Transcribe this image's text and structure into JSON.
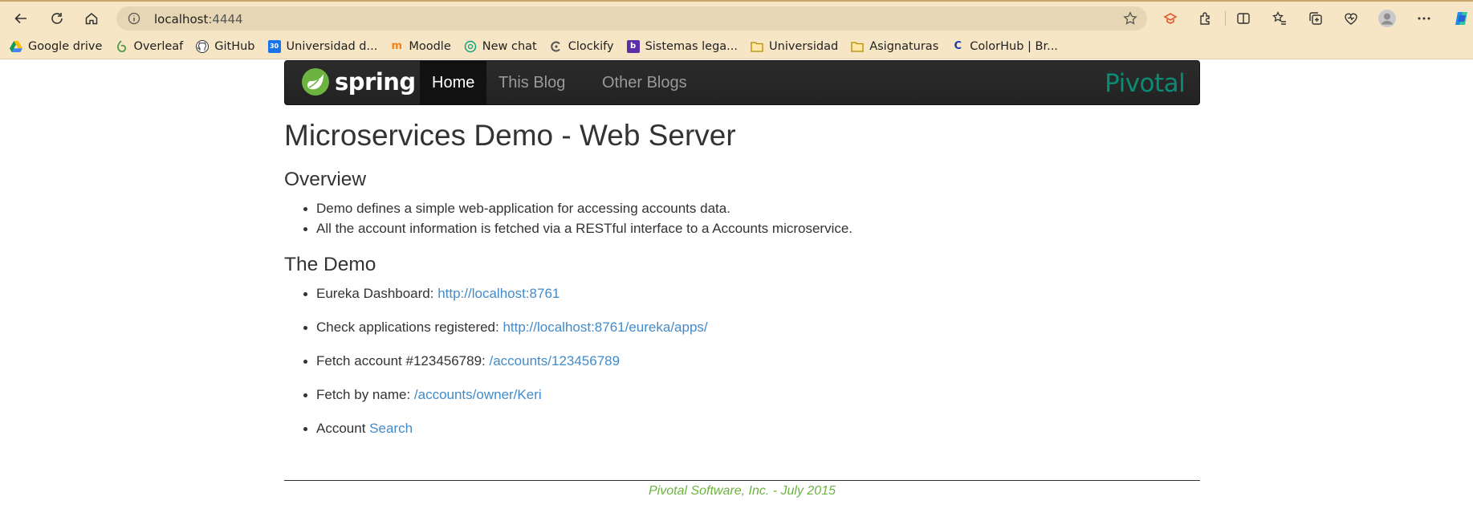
{
  "browser": {
    "url_host": "localhost",
    "url_port": ":4444",
    "bookmarks": [
      {
        "label": "Google drive",
        "icon": "google-drive-icon"
      },
      {
        "label": "Overleaf",
        "icon": "overleaf-icon"
      },
      {
        "label": "GitHub",
        "icon": "github-icon"
      },
      {
        "label": "Universidad d...",
        "icon": "calendar-icon"
      },
      {
        "label": "Moodle",
        "icon": "moodle-icon"
      },
      {
        "label": "New chat",
        "icon": "chatgpt-icon"
      },
      {
        "label": "Clockify",
        "icon": "clockify-icon"
      },
      {
        "label": "Sistemas lega...",
        "icon": "bookmark-app-icon"
      },
      {
        "label": "Universidad",
        "icon": "folder-icon"
      },
      {
        "label": "Asignaturas",
        "icon": "folder-icon"
      },
      {
        "label": "ColorHub | Br...",
        "icon": "colorhub-icon"
      }
    ]
  },
  "navbar": {
    "brand": "spring",
    "items": [
      {
        "label": "Home",
        "active": true
      },
      {
        "label": "This Blog",
        "active": false
      },
      {
        "label": "Other Blogs",
        "active": false
      }
    ],
    "partner_logo": "Pivotal"
  },
  "page": {
    "title": "Microservices Demo - Web Server",
    "overview_heading": "Overview",
    "overview_items": [
      "Demo defines a simple web-application for accessing accounts data.",
      "All the account information is fetched via a RESTful interface to a Accounts microservice."
    ],
    "demo_heading": "The Demo",
    "demo_items": [
      {
        "text": "Eureka Dashboard: ",
        "link": "http://localhost:8761"
      },
      {
        "text": "Check applications registered: ",
        "link": "http://localhost:8761/eureka/apps/"
      },
      {
        "text": "Fetch account #123456789: ",
        "link": "/accounts/123456789"
      },
      {
        "text": "Fetch by name: ",
        "link": "/accounts/owner/Keri"
      },
      {
        "text": "Account ",
        "link": "Search"
      }
    ],
    "footer": "Pivotal Software, Inc. - July 2015"
  },
  "colors": {
    "link": "#428bca",
    "footer": "#6db33f",
    "spring_green": "#6db33f",
    "pivotal_teal": "#0b8a74",
    "chrome_bg": "#f6e6c6"
  }
}
